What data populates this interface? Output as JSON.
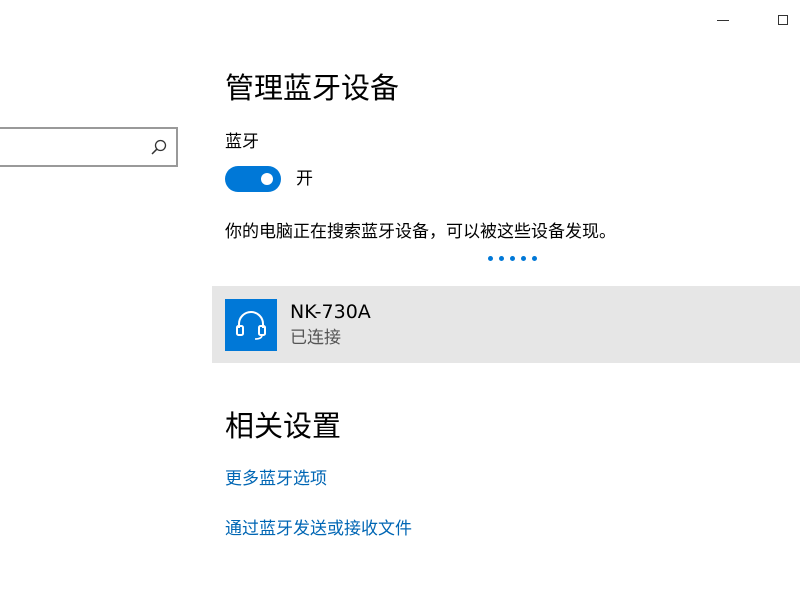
{
  "window": {
    "controls": {
      "minimize_icon": "minimize-icon",
      "maximize_icon": "maximize-icon"
    }
  },
  "search": {
    "value": "",
    "placeholder": "",
    "icon": "search-icon"
  },
  "main": {
    "title": "管理蓝牙设备",
    "bluetooth_label": "蓝牙",
    "toggle": {
      "on": true,
      "state_label": "开",
      "accent": "#0078d7"
    },
    "status_text": "你的电脑正在搜索蓝牙设备，可以被这些设备发现。",
    "devices": [
      {
        "name": "NK-730A",
        "status": "已连接",
        "icon": "headset-icon"
      }
    ]
  },
  "related": {
    "title": "相关设置",
    "links": [
      {
        "label": "更多蓝牙选项"
      },
      {
        "label": "通过蓝牙发送或接收文件"
      }
    ]
  },
  "colors": {
    "accent": "#0078d7",
    "link": "#0066b4",
    "selected_item_bg": "#e6e6e6"
  }
}
